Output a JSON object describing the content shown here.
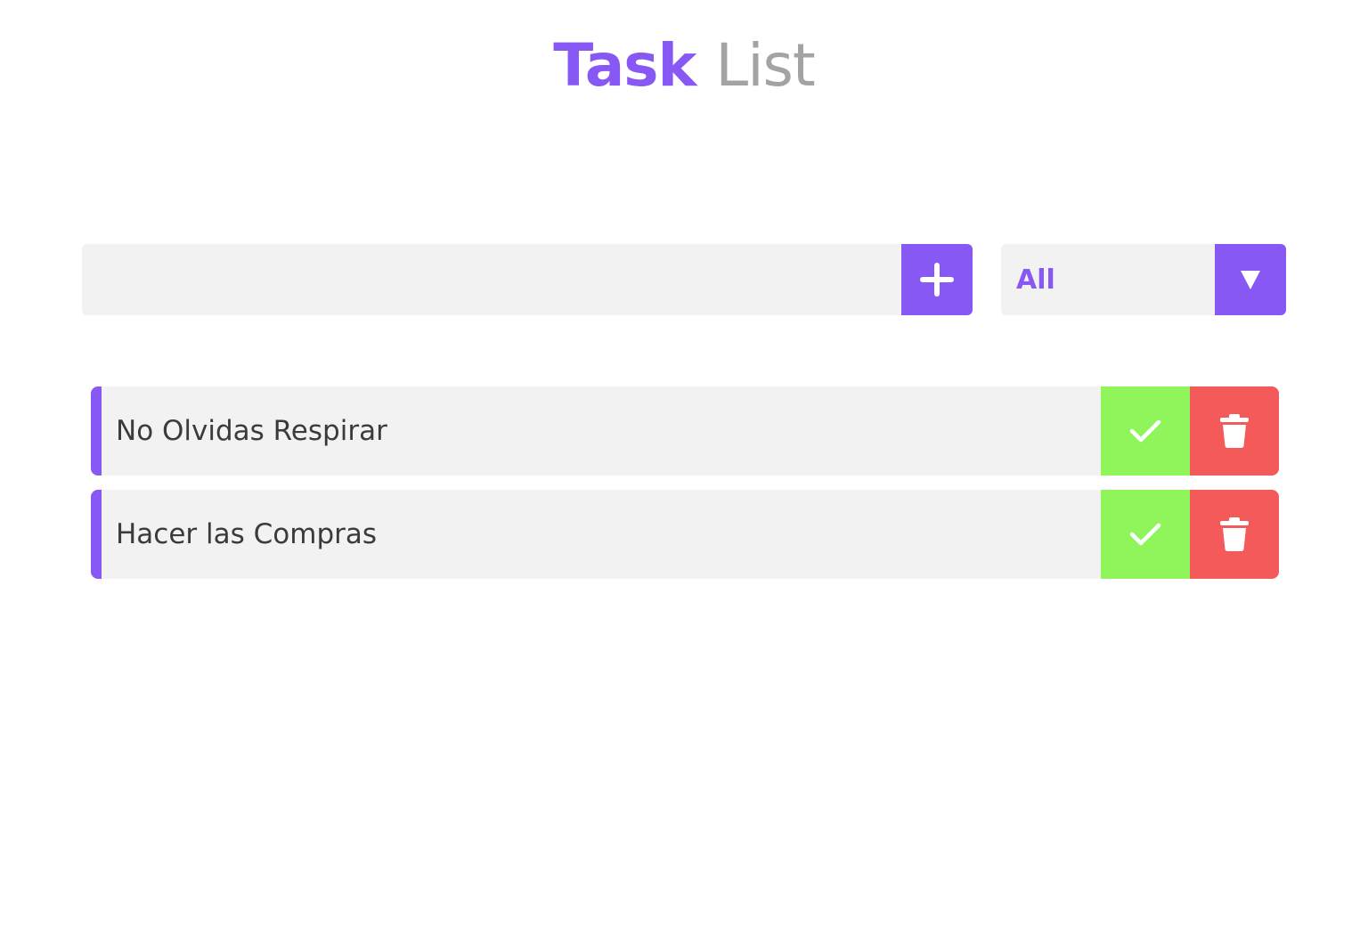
{
  "header": {
    "title_part_1": "Task",
    "title_part_2": "List"
  },
  "task_form": {
    "input_value": "",
    "input_placeholder": "",
    "add_icon": "plus-icon"
  },
  "filter": {
    "selected": "All",
    "arrow_icon": "triangle-down-icon"
  },
  "tasks": [
    {
      "text": "No Olvidas Respirar",
      "complete_icon": "check-icon",
      "delete_icon": "trash-icon"
    },
    {
      "text": "Hacer las Compras",
      "complete_icon": "check-icon",
      "delete_icon": "trash-icon"
    }
  ],
  "colors": {
    "accent": "#8758f4",
    "title_muted": "#a3a3a3",
    "field_background": "#f2f2f2",
    "complete_button": "#8ff55a",
    "delete_button": "#f45a5a",
    "text": "#3b3b3b"
  }
}
